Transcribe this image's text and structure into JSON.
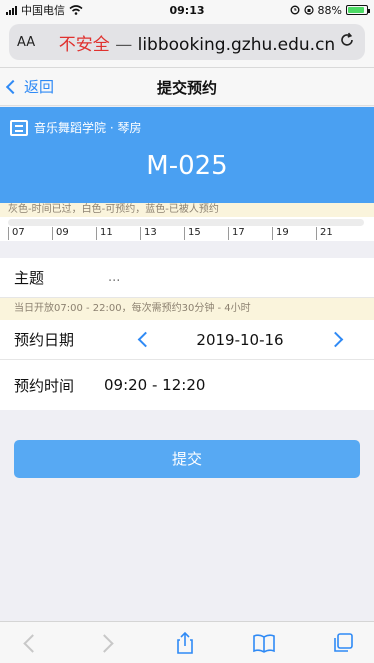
{
  "status_bar": {
    "carrier": "中国电信",
    "time": "09:13",
    "battery": "88%",
    "battery_level": 0.88
  },
  "browser": {
    "text_size_label": "AA",
    "security_label": "不安全",
    "separator": "—",
    "domain": "libbooking.gzhu.edu.cn"
  },
  "header": {
    "back_label": "返回",
    "title": "提交预约"
  },
  "room": {
    "location": "音乐舞蹈学院 · 琴房",
    "code": "M-025"
  },
  "timeline": {
    "legend": "灰色-时间已过，白色-可预约，蓝色-已被人预约",
    "ticks": [
      "07",
      "09",
      "11",
      "13",
      "15",
      "17",
      "19",
      "21"
    ]
  },
  "form": {
    "subject_label": "主题",
    "subject_placeholder": "...",
    "hours_note": "当日开放07:00 - 22:00，每次需预约30分钟 - 4小时",
    "date_label": "预约日期",
    "date_value": "2019-10-16",
    "time_label": "预约时间",
    "time_value": "09:20 - 12:20"
  },
  "submit_label": "提交",
  "colors": {
    "accent": "#2f8af5",
    "card_blue": "#4aa0f2",
    "insecure_red": "#e0312e",
    "button_blue": "#57a9f3"
  }
}
